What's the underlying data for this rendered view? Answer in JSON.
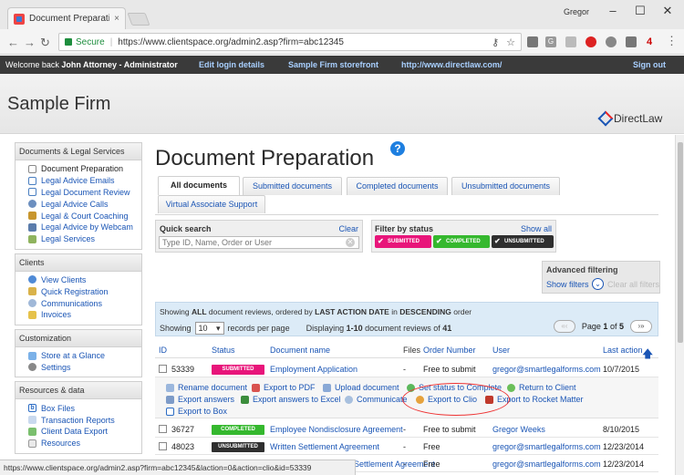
{
  "browser": {
    "tab_title": "Document Preparation |",
    "tab_close": "×",
    "window_user": "Gregor",
    "secure_label": "Secure",
    "url": "https://www.clientspace.org/admin2.asp?firm=abc12345",
    "status_url": "https://www.clientspace.org/admin2.asp?firm=abc12345&laction=0&action=clio&id=53339",
    "ext_badge": "4"
  },
  "sitebar": {
    "welcome_prefix": "Welcome back",
    "user": "John Attorney - Administrator",
    "edit_login": "Edit login details",
    "storefront": "Sample Firm storefront",
    "site_url": "http://www.directlaw.com/",
    "sign_out": "Sign out"
  },
  "header": {
    "firm_name": "Sample Firm",
    "logo_text": "DirectLaw"
  },
  "sidebar": {
    "sections": [
      {
        "title": "Documents & Legal Services",
        "items": [
          {
            "label": "Document Preparation",
            "icon": "document-icon"
          },
          {
            "label": "Legal Advice Emails",
            "icon": "mail-icon"
          },
          {
            "label": "Legal Document Review",
            "icon": "mail-icon"
          },
          {
            "label": "Legal Advice Calls",
            "icon": "phone-icon"
          },
          {
            "label": "Legal & Court Coaching",
            "icon": "gavel-icon"
          },
          {
            "label": "Legal Advice by Webcam",
            "icon": "webcam-icon"
          },
          {
            "label": "Legal Services",
            "icon": "law-icon"
          }
        ]
      },
      {
        "title": "Clients",
        "items": [
          {
            "label": "View Clients",
            "icon": "user-icon"
          },
          {
            "label": "Quick Registration",
            "icon": "register-icon"
          },
          {
            "label": "Communications",
            "icon": "chat-icon"
          },
          {
            "label": "Invoices",
            "icon": "invoice-icon"
          }
        ]
      },
      {
        "title": "Customization",
        "items": [
          {
            "label": "Store at a Glance",
            "icon": "store-icon"
          },
          {
            "label": "Settings",
            "icon": "gear-icon"
          }
        ]
      },
      {
        "title": "Resources & data",
        "items": [
          {
            "label": "Box Files",
            "icon": "box-icon"
          },
          {
            "label": "Transaction Reports",
            "icon": "report-icon"
          },
          {
            "label": "Client Data Export",
            "icon": "export-icon"
          },
          {
            "label": "Resources",
            "icon": "resources-icon"
          }
        ]
      }
    ]
  },
  "main": {
    "title": "Document Preparation",
    "help": "?",
    "tabs": [
      "All documents",
      "Submitted documents",
      "Completed documents",
      "Unsubmitted documents",
      "Virtual Associate Support"
    ],
    "quick_search": {
      "label": "Quick search",
      "clear": "Clear",
      "placeholder": "Type ID, Name, Order or User"
    },
    "filter": {
      "label": "Filter by status",
      "show_all": "Show all",
      "chips": [
        "SUBMITTED",
        "COMPLETED",
        "UNSUBMITTED"
      ]
    },
    "advanced": {
      "label": "Advanced filtering",
      "show": "Show filters",
      "clear": "Clear all filters"
    },
    "summary": {
      "showing": "Showing",
      "all": "ALL",
      "middle": "document reviews, ordered by",
      "field": "LAST ACTION DATE",
      "in": "in",
      "order": "DESCENDING",
      "suffix": "order",
      "per_page_prefix": "Showing",
      "per_page_value": "10",
      "per_page_suffix": "records per page",
      "displaying_prefix": "Displaying",
      "displaying_range": "1-10",
      "displaying_middle": "document reviews of",
      "displaying_total": "41",
      "page_prefix": "Page",
      "page": "1",
      "page_of": "of",
      "pages": "5"
    },
    "table": {
      "headers": [
        "ID",
        "Status",
        "Document name",
        "Files",
        "Order Number",
        "User",
        "Last action"
      ],
      "rows": [
        {
          "id": "53339",
          "status": "SUBMITTED",
          "name": "Employment Application",
          "files": "-",
          "order": "Free to submit",
          "user": "gregor@smartlegalforms.com",
          "date": "10/7/2015"
        },
        {
          "id": "36727",
          "status": "COMPLETED",
          "name": "Employee Nondisclosure Agreement",
          "files": "-",
          "order": "Free to submit",
          "user": "Gregor Weeks",
          "date": "8/10/2015"
        },
        {
          "id": "48023",
          "status": "UNSUBMITTED",
          "name": "Written Settlement Agreement",
          "files": "-",
          "order": "Free",
          "user": "gregor@smartlegalforms.com",
          "date": "12/23/2014"
        },
        {
          "id": "",
          "status": "",
          "name": "Settlement Agreement",
          "files": "-",
          "order": "Free",
          "user": "gregor@smartlegalforms.com",
          "date": "12/23/2014"
        }
      ],
      "actions": [
        "Rename document",
        "Export to PDF",
        "Upload document",
        "Set status to Complete",
        "Return to Client",
        "Export answers",
        "Export answers to Excel",
        "Communicate",
        "Export to Clio",
        "Export to Rocket Matter",
        "Export to Box"
      ]
    }
  },
  "colors": {
    "submitted": "#e8157a",
    "completed": "#35b82e",
    "unsubmitted": "#2f2f2f",
    "link": "#1a55b5",
    "highlight": "#e33333"
  }
}
